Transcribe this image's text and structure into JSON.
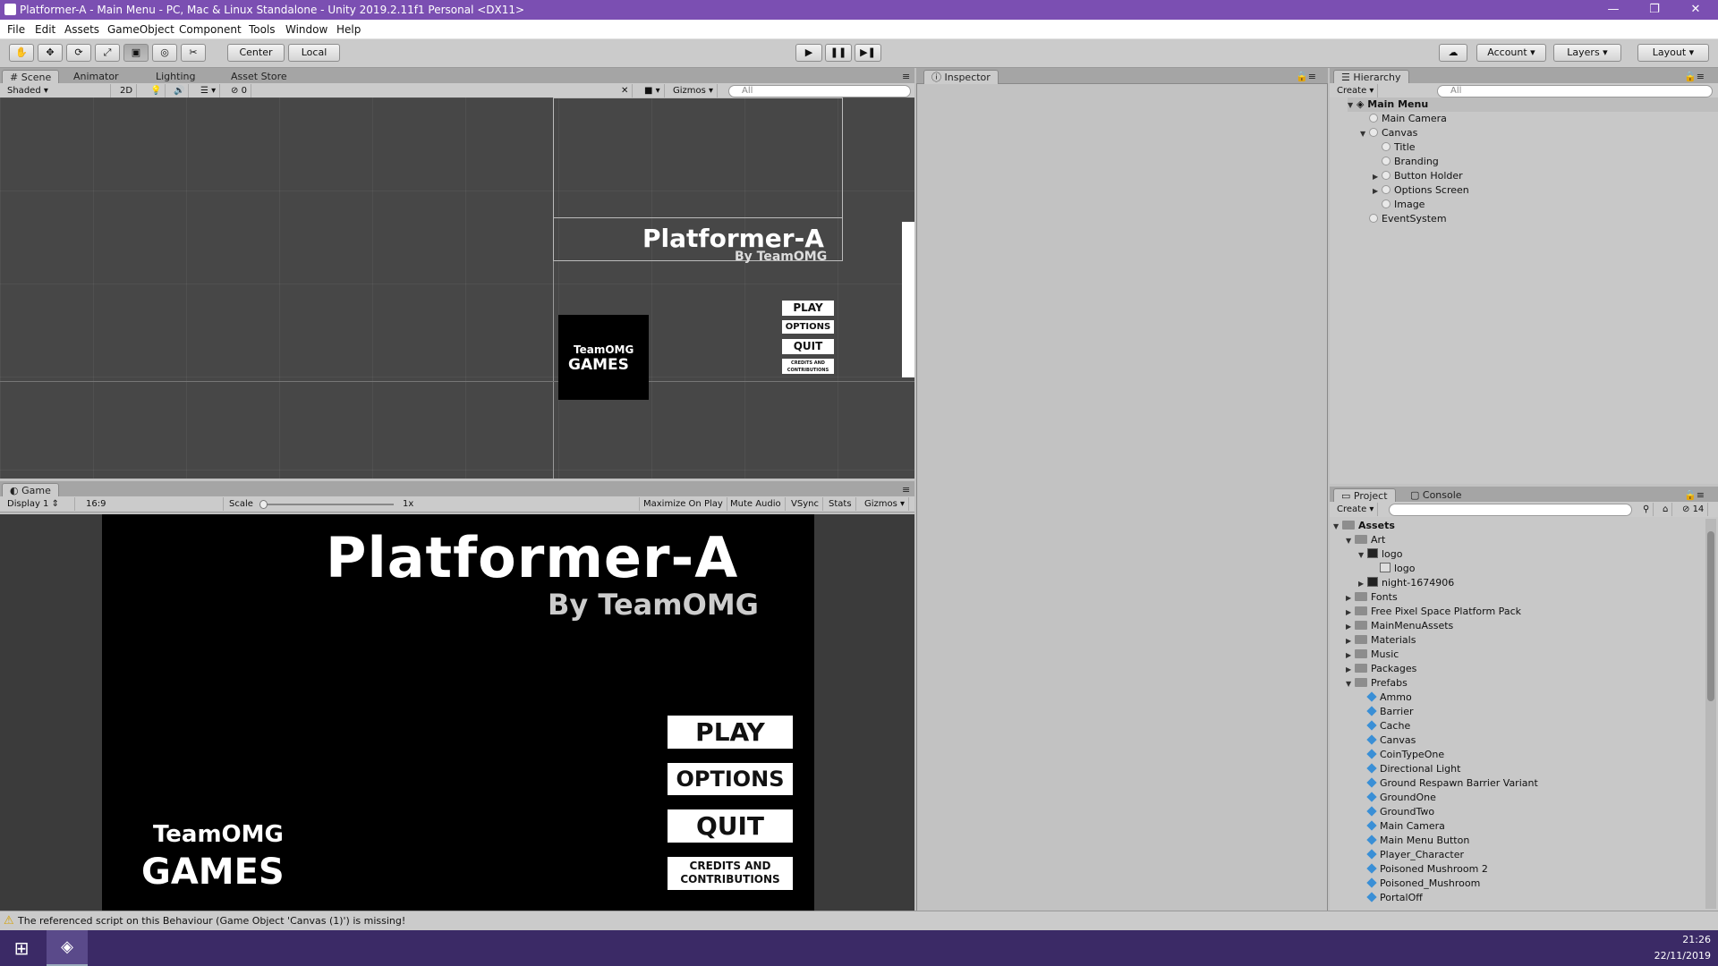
{
  "window": {
    "title": "Platformer-A - Main Menu - PC, Mac & Linux Standalone - Unity 2019.2.11f1 Personal <DX11>",
    "controls": [
      "—",
      "❐",
      "✕"
    ]
  },
  "menu": [
    "File",
    "Edit",
    "Assets",
    "GameObject",
    "Component",
    "Tools",
    "Window",
    "Help"
  ],
  "toolbar": {
    "pivot": "Center",
    "space": "Local",
    "account": "Account",
    "layers": "Layers",
    "layout": "Layout"
  },
  "scene": {
    "tabs": [
      "Scene",
      "Animator",
      "Lighting",
      "Asset Store"
    ],
    "shading": "Shaded",
    "mode2d": "2D",
    "hidden_count": "0",
    "gizmos": "Gizmos",
    "search_placeholder": "All",
    "preview": {
      "title": "Platformer-A",
      "subtitle": "By TeamOMG",
      "logo_top": "TeamOMG",
      "logo_bottom": "GAMES",
      "buttons": [
        "PLAY",
        "OPTIONS",
        "QUIT",
        "CREDITS AND CONTRIBUTIONS"
      ]
    }
  },
  "game": {
    "tab": "Game",
    "display": "Display 1",
    "aspect": "16:9",
    "scale_label": "Scale",
    "scale_value": "1x",
    "toggles": [
      "Maximize On Play",
      "Mute Audio",
      "VSync",
      "Stats",
      "Gizmos"
    ],
    "title": "Platformer-A",
    "subtitle": "By TeamOMG",
    "logo_top": "TeamOMG",
    "logo_bottom": "GAMES",
    "buttons": [
      "PLAY",
      "OPTIONS",
      "QUIT",
      "CREDITS AND\nCONTRIBUTIONS"
    ]
  },
  "inspector": {
    "tab": "Inspector"
  },
  "hierarchy": {
    "tab": "Hierarchy",
    "create": "Create",
    "search_placeholder": "All",
    "root": "Main Menu",
    "items": [
      {
        "label": "Main Camera",
        "depth": 1,
        "arrow": ""
      },
      {
        "label": "Canvas",
        "depth": 1,
        "arrow": "▼"
      },
      {
        "label": "Title",
        "depth": 2,
        "arrow": ""
      },
      {
        "label": "Branding",
        "depth": 2,
        "arrow": ""
      },
      {
        "label": "Button Holder",
        "depth": 2,
        "arrow": "▶"
      },
      {
        "label": "Options Screen",
        "depth": 2,
        "arrow": "▶"
      },
      {
        "label": "Image",
        "depth": 2,
        "arrow": ""
      },
      {
        "label": "EventSystem",
        "depth": 1,
        "arrow": ""
      }
    ]
  },
  "project": {
    "tabs": [
      "Project",
      "Console"
    ],
    "create": "Create",
    "hidden_count": "14",
    "root": "Assets",
    "items": [
      {
        "label": "Art",
        "depth": 1,
        "arrow": "▼",
        "kind": "folder"
      },
      {
        "label": "logo",
        "depth": 2,
        "arrow": "▼",
        "kind": "image"
      },
      {
        "label": "logo",
        "depth": 3,
        "arrow": "",
        "kind": "sprite"
      },
      {
        "label": "night-1674906",
        "depth": 2,
        "arrow": "▶",
        "kind": "image"
      },
      {
        "label": "Fonts",
        "depth": 1,
        "arrow": "▶",
        "kind": "folder"
      },
      {
        "label": "Free Pixel Space Platform Pack",
        "depth": 1,
        "arrow": "▶",
        "kind": "folder"
      },
      {
        "label": "MainMenuAssets",
        "depth": 1,
        "arrow": "▶",
        "kind": "folder"
      },
      {
        "label": "Materials",
        "depth": 1,
        "arrow": "▶",
        "kind": "folder"
      },
      {
        "label": "Music",
        "depth": 1,
        "arrow": "▶",
        "kind": "folder"
      },
      {
        "label": "Packages",
        "depth": 1,
        "arrow": "▶",
        "kind": "folder"
      },
      {
        "label": "Prefabs",
        "depth": 1,
        "arrow": "▼",
        "kind": "folder"
      },
      {
        "label": "Ammo",
        "depth": 2,
        "arrow": "",
        "kind": "prefab"
      },
      {
        "label": "Barrier",
        "depth": 2,
        "arrow": "",
        "kind": "prefab"
      },
      {
        "label": "Cache",
        "depth": 2,
        "arrow": "",
        "kind": "prefab"
      },
      {
        "label": "Canvas",
        "depth": 2,
        "arrow": "",
        "kind": "prefab"
      },
      {
        "label": "CoinTypeOne",
        "depth": 2,
        "arrow": "",
        "kind": "prefab"
      },
      {
        "label": "Directional Light",
        "depth": 2,
        "arrow": "",
        "kind": "prefab"
      },
      {
        "label": "Ground Respawn Barrier Variant",
        "depth": 2,
        "arrow": "",
        "kind": "prefab"
      },
      {
        "label": "GroundOne",
        "depth": 2,
        "arrow": "",
        "kind": "prefab"
      },
      {
        "label": "GroundTwo",
        "depth": 2,
        "arrow": "",
        "kind": "prefab"
      },
      {
        "label": "Main Camera",
        "depth": 2,
        "arrow": "",
        "kind": "prefab"
      },
      {
        "label": "Main Menu Button",
        "depth": 2,
        "arrow": "",
        "kind": "prefab"
      },
      {
        "label": "Player_Character",
        "depth": 2,
        "arrow": "",
        "kind": "prefab"
      },
      {
        "label": "Poisoned Mushroom 2",
        "depth": 2,
        "arrow": "",
        "kind": "prefab"
      },
      {
        "label": "Poisoned_Mushroom",
        "depth": 2,
        "arrow": "",
        "kind": "prefab"
      },
      {
        "label": "PortalOff",
        "depth": 2,
        "arrow": "",
        "kind": "prefab"
      }
    ]
  },
  "status": {
    "message": "The referenced script on this Behaviour (Game Object 'Canvas (1)') is missing!"
  },
  "taskbar": {
    "time": "21:26",
    "date": "22/11/2019"
  },
  "colors": {
    "titlebar": "#7b4fb2",
    "taskbar": "#3b2a66",
    "prefab": "#3a8fd6"
  }
}
